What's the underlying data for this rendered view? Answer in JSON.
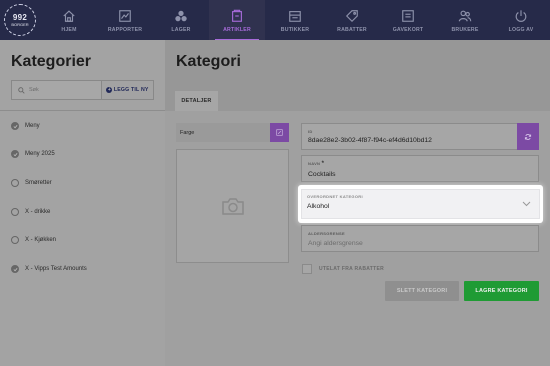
{
  "app": {
    "logo_line1": "992",
    "logo_line2": "BORGER"
  },
  "nav": {
    "items": [
      {
        "label": "HJEM",
        "icon": "home-icon"
      },
      {
        "label": "RAPPORTER",
        "icon": "chart-icon"
      },
      {
        "label": "LAGER",
        "icon": "boxes-icon"
      },
      {
        "label": "ARTIKLER",
        "icon": "tag-box-icon",
        "active": true
      },
      {
        "label": "BUTIKKER",
        "icon": "store-icon"
      },
      {
        "label": "RABATTER",
        "icon": "discount-tag-icon"
      },
      {
        "label": "GAVEKORT",
        "icon": "gift-card-icon"
      },
      {
        "label": "BRUKERE",
        "icon": "users-icon"
      },
      {
        "label": "LOGG AV",
        "icon": "power-icon"
      }
    ],
    "accent": "#a66bd9"
  },
  "sidebar": {
    "title": "Kategorier",
    "search_placeholder": "Søk",
    "add_label": "LEGG TIL NY",
    "categories": [
      {
        "label": "Meny",
        "checked": true
      },
      {
        "label": "Meny 2025",
        "checked": true
      },
      {
        "label": "Smøretter",
        "checked": false
      },
      {
        "label": "X - drikke",
        "checked": false
      },
      {
        "label": "X - Kjøkken",
        "checked": false
      },
      {
        "label": "X - Vipps Test Amounts",
        "checked": true
      }
    ]
  },
  "main": {
    "title": "Kategori",
    "tab_label": "DETALJER",
    "color_label": "Farge",
    "fields": {
      "id_label": "ID",
      "id_value": "8dae28e2-3b02-4f87-f94c-ef4d6d10bd12",
      "name_label": "NAVN",
      "name_required": "*",
      "name_value": "Cocktails",
      "parent_label": "OVERORDNET KATEGORI",
      "parent_value": "Alkohol",
      "age_label": "ALDERSGRENSE",
      "age_placeholder": "Angi aldersgrense"
    },
    "exclude_label": "UTELAT FRA RABATTER",
    "delete_label": "SLETT KATEGORI",
    "save_label": "LAGRE KATEGORI"
  },
  "colors": {
    "nav_bg": "#262a49",
    "purple": "#7c4aa4",
    "save_green": "#1f9b34"
  }
}
